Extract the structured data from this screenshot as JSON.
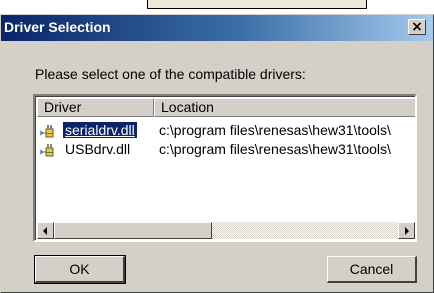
{
  "dialog": {
    "title": "Driver Selection",
    "close_glyph": "×",
    "prompt": "Please select one of the compatible drivers:"
  },
  "list": {
    "columns": [
      "Driver",
      "Location"
    ],
    "rows": [
      {
        "name": "serialdrv.dll",
        "location": "c:\\program files\\renesas\\hew31\\tools\\",
        "icon": "plug-icon",
        "selected": true
      },
      {
        "name": "USBdrv.dll",
        "location": "c:\\program files\\renesas\\hew31\\tools\\",
        "icon": "plug-icon",
        "selected": false
      }
    ]
  },
  "buttons": {
    "ok_label": "OK",
    "cancel_label": "Cancel"
  },
  "colors": {
    "title_start": "#0a246a",
    "title_end": "#a6caf0",
    "face": "#d4d0c8",
    "selection": "#0a246a"
  }
}
